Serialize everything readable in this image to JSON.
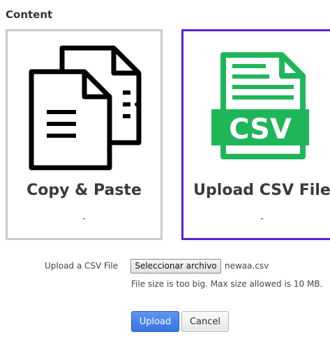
{
  "section": {
    "title": "Content"
  },
  "cards": [
    {
      "title": "Copy & Paste",
      "subtitle": "-",
      "icon": "documents-icon",
      "selected": false
    },
    {
      "title": "Upload CSV File",
      "subtitle": "-",
      "icon": "csv-file-icon",
      "icon_text": "CSV",
      "selected": true
    }
  ],
  "upload": {
    "label": "Upload a CSV File",
    "choose_button": "Seleccionar archivo",
    "file_name": "newaa.csv",
    "error": "File size is too big. Max size allowed is 10 MB."
  },
  "actions": {
    "upload_label": "Upload",
    "cancel_label": "Cancel"
  },
  "colors": {
    "selected_border": "#5b21d6",
    "unselected_border": "#cccccc",
    "csv_green": "#1fb65a",
    "primary_button": "#3874e4"
  }
}
